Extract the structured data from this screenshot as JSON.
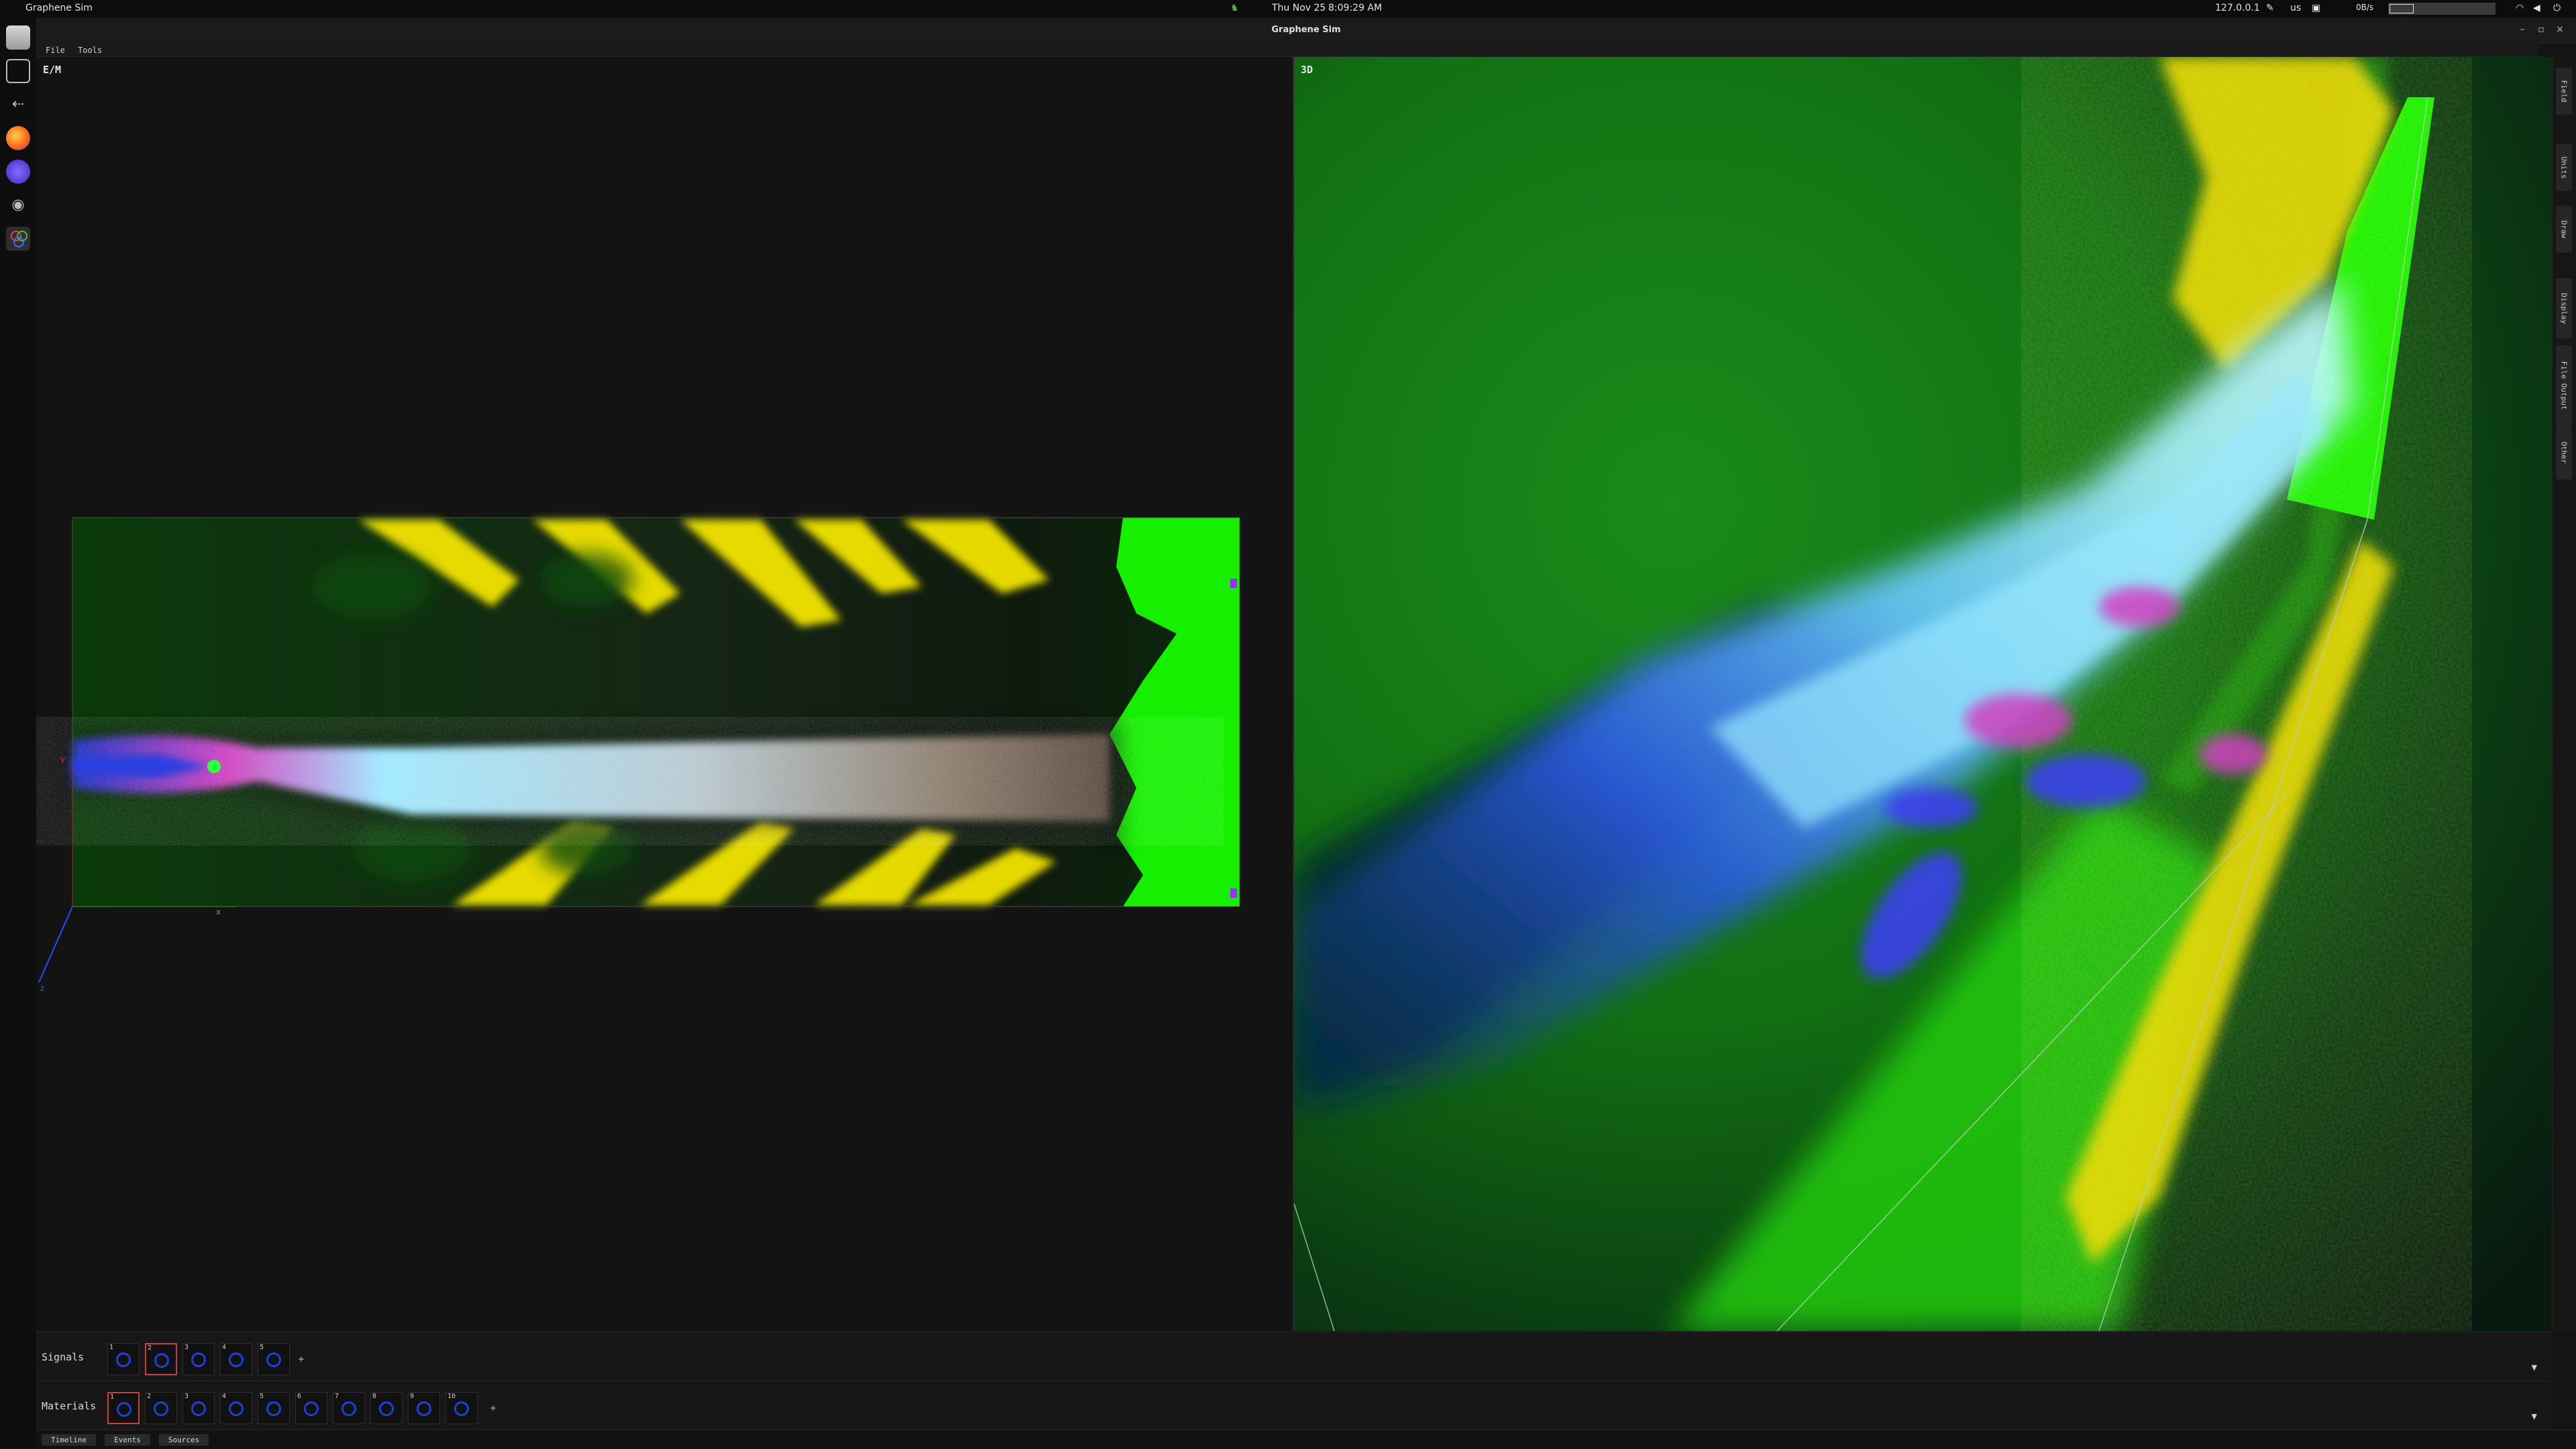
{
  "system_bar": {
    "app_name": "Graphene Sim",
    "date": "Thu Nov 25",
    "time": "8:09:29 AM",
    "ip": "127.0.0.1",
    "keyboard_layout": "us",
    "net_speed": "0B/s"
  },
  "window": {
    "title": "Graphene Sim"
  },
  "menu": {
    "items": [
      "File",
      "Tools"
    ]
  },
  "views": {
    "left": {
      "label": "E/M"
    },
    "right": {
      "label": "3D"
    }
  },
  "left_axes": {
    "x": "x",
    "y": "y",
    "z": "z"
  },
  "side_tabs": [
    "Field",
    "Units",
    "Draw",
    "Display",
    "File Output",
    "Other"
  ],
  "signals": {
    "label": "Signals",
    "slots": [
      "1",
      "2",
      "3",
      "4",
      "5"
    ],
    "selected": 2
  },
  "materials": {
    "label": "Materials",
    "slots": [
      "1",
      "2",
      "3",
      "4",
      "5",
      "6",
      "7",
      "8",
      "9",
      "10"
    ],
    "selected": 1
  },
  "bottom_tabs": [
    "Timeline",
    "Events",
    "Sources"
  ],
  "dock_icons": [
    "files-icon",
    "sim-panel-icon",
    "arrow-icon",
    "firefox-icon",
    "app-icon",
    "eye-icon",
    "graphene-icon"
  ],
  "colors": {
    "field_green": "#11ee00",
    "field_yellow": "#f2e400",
    "beam_cyan": "#a8f0ff",
    "beam_blue": "#2a46e6",
    "beam_magenta": "#e040c0",
    "accent_red": "#c84040"
  }
}
